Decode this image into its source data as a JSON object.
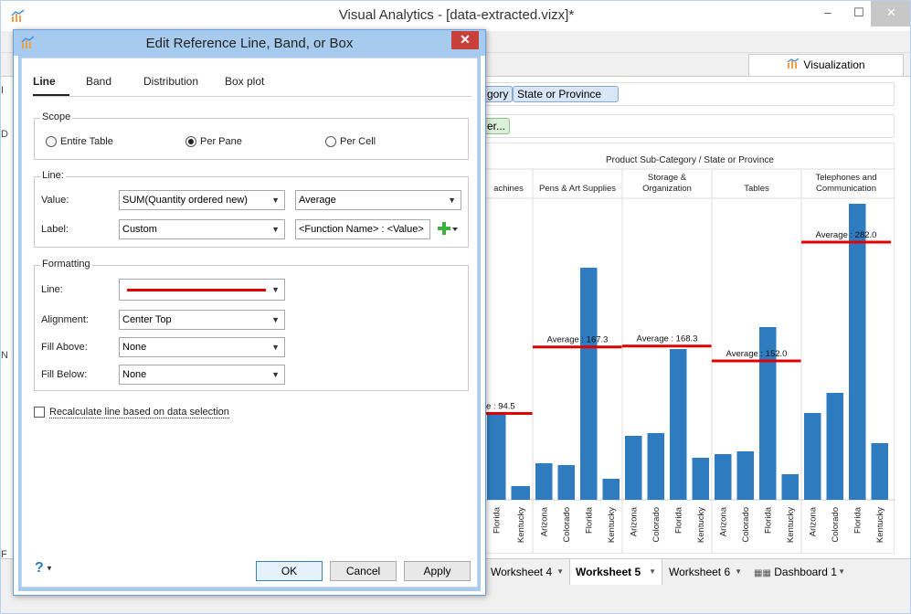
{
  "app": {
    "title": "Visual Analytics - [data-extracted.vizx]*",
    "visualization_tab": "Visualization",
    "shelf_columns_pills": [
      "gory",
      "State or Province"
    ],
    "shelf_filter_pill": "er..."
  },
  "chart_data": {
    "type": "bar",
    "title": "Product Sub-Category / State or Province",
    "panes": [
      {
        "name": "achines",
        "categories": [
          "Florida",
          "Kentucky"
        ],
        "values": [
          95,
          15
        ],
        "average_label": "e : 94.5",
        "average": 94.5
      },
      {
        "name": "Pens & Art Supplies",
        "categories": [
          "Arizona",
          "Colorado",
          "Florida",
          "Kentucky"
        ],
        "values": [
          40,
          38,
          254,
          23
        ],
        "average_label": "Average : 167.3",
        "average": 167.3
      },
      {
        "name": "Storage & Organization",
        "categories": [
          "Arizona",
          "Colorado",
          "Florida",
          "Kentucky"
        ],
        "values": [
          70,
          73,
          165,
          46
        ],
        "average_label": "Average : 168.3",
        "average": 168.3
      },
      {
        "name": "Tables",
        "categories": [
          "Arizona",
          "Colorado",
          "Florida",
          "Kentucky"
        ],
        "values": [
          50,
          53,
          189,
          28
        ],
        "average_label": "Average : 152.0",
        "average": 152.0
      },
      {
        "name": "Telephones and Communication",
        "categories": [
          "Arizona",
          "Colorado",
          "Florida",
          "Kentucky"
        ],
        "values": [
          95,
          117,
          324,
          62
        ],
        "average_label": "Average : 282.0",
        "average": 282.0
      }
    ],
    "ylim": [
      0,
      330
    ],
    "reference_line_color": "#e00000",
    "bar_color": "#2e7bbf"
  },
  "worksheets": {
    "tabs": [
      "Worksheet 4",
      "Worksheet 5",
      "Worksheet 6",
      "Dashboard 1"
    ],
    "active": "Worksheet 5"
  },
  "dialog": {
    "title": "Edit Reference Line, Band, or Box",
    "tabs": [
      "Line",
      "Band",
      "Distribution",
      "Box plot"
    ],
    "active_tab": "Line",
    "scope": {
      "legend": "Scope",
      "options": [
        "Entire Table",
        "Per Pane",
        "Per Cell"
      ],
      "selected": "Per Pane"
    },
    "line": {
      "legend": "Line:",
      "value_label": "Value:",
      "value_field": "SUM(Quantity ordered new)",
      "value_agg": "Average",
      "label_label": "Label:",
      "label_type": "Custom",
      "label_text": "<Function Name> : <Value>"
    },
    "formatting": {
      "legend": "Formatting",
      "line_label": "Line:",
      "line_color": "#e00000",
      "alignment_label": "Alignment:",
      "alignment": "Center Top",
      "fill_above_label": "Fill Above:",
      "fill_above": "None",
      "fill_below_label": "Fill Below:",
      "fill_below": "None"
    },
    "recalculate": "Recalculate line based on data selection",
    "help": "?",
    "buttons": {
      "ok": "OK",
      "cancel": "Cancel",
      "apply": "Apply"
    }
  }
}
